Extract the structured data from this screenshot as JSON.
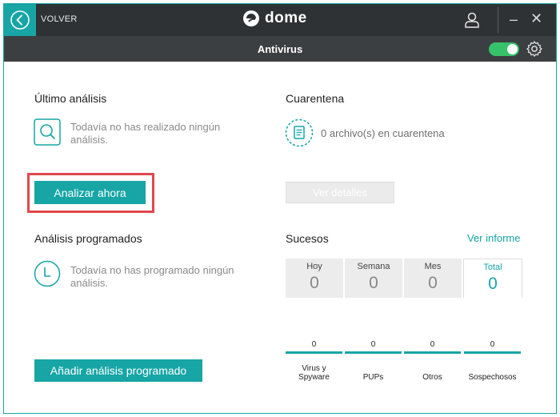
{
  "titlebar": {
    "back_label": "VOLVER",
    "logo_text": "dome",
    "minimize": "–",
    "close": "✕"
  },
  "subheader": {
    "title": "Antivirus",
    "protection_enabled": true
  },
  "last_scan": {
    "title": "Último análisis",
    "message": "Todavía no has realizado ningún análisis.",
    "button": "Analizar ahora"
  },
  "quarantine": {
    "title": "Cuarentena",
    "message": "0 archivo(s) en cuarentena",
    "button": "Ver detalles"
  },
  "scheduled": {
    "title": "Análisis programados",
    "message": "Todavía no has programado ningún análisis.",
    "button": "Añadir análisis programado"
  },
  "events": {
    "title": "Sucesos",
    "report_link": "Ver informe",
    "periods": [
      {
        "label": "Hoy",
        "value": "0"
      },
      {
        "label": "Semana",
        "value": "0"
      },
      {
        "label": "Mes",
        "value": "0"
      },
      {
        "label": "Total",
        "value": "0"
      }
    ],
    "categories": [
      {
        "count": "0",
        "name": "Virus y Spyware"
      },
      {
        "count": "0",
        "name": "PUPs"
      },
      {
        "count": "0",
        "name": "Otros"
      },
      {
        "count": "0",
        "name": "Sospechosos"
      }
    ]
  },
  "colors": {
    "accent": "#17a5a5",
    "toggle_on": "#36c26b",
    "highlight": "#e0484d",
    "titlebar": "#2f3235"
  }
}
